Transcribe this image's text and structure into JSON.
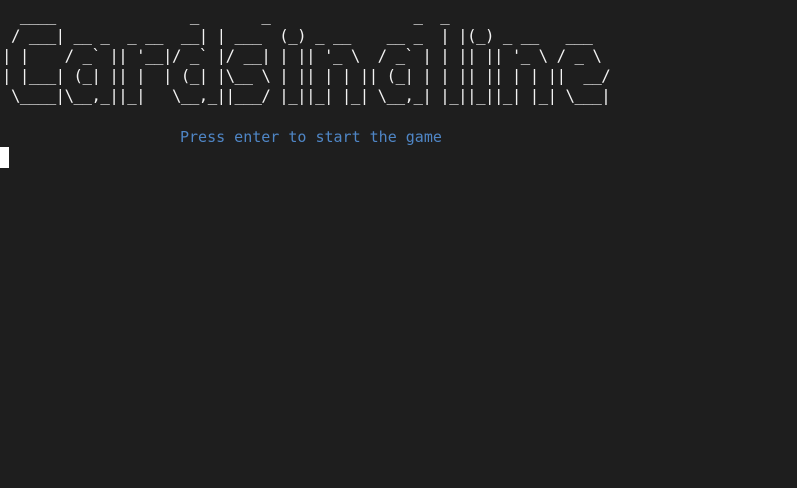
{
  "terminal": {
    "banner_lines": [
      "  ____               _       _                _  _",
      " / ___| __ _  _ __  __| | ___  (_) _ __    __ _  | |(_) _ __   ___",
      "| |    / _` || '__|/ _` |/ __| | || '_ \\  / _` | | || || '_ \\ / _ \\",
      "| |___| (_| || |  | (_| |\\__ \\ | || | | || (_| | | || || | | ||  __/",
      " \\____|\\__,_||_|   \\__,_||___/ |_||_| |_| \\__,_| |_||_||_| |_| \\___|"
    ],
    "prompt_text": "Press enter to start the game"
  },
  "colors": {
    "background": "#1e1e1e",
    "banner": "#f2f2f2",
    "prompt": "#4f86c6",
    "cursor": "#ffffff"
  }
}
